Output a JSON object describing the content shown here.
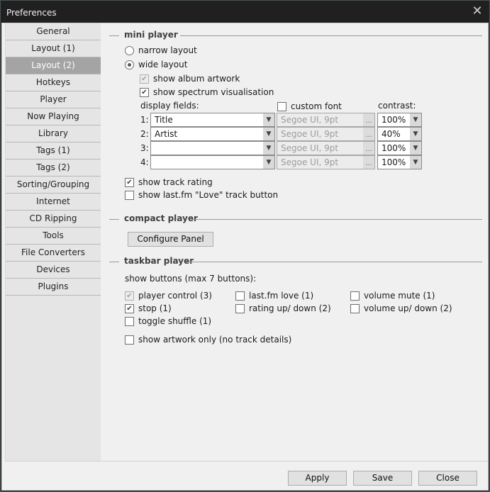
{
  "window": {
    "title": "Preferences",
    "close_glyph": "✕"
  },
  "sidebar": {
    "items": [
      {
        "label": "General"
      },
      {
        "label": "Layout (1)"
      },
      {
        "label": "Layout (2)",
        "active": true
      },
      {
        "label": "Hotkeys"
      },
      {
        "label": "Player"
      },
      {
        "label": "Now Playing"
      },
      {
        "label": "Library"
      },
      {
        "label": "Tags (1)"
      },
      {
        "label": "Tags (2)"
      },
      {
        "label": "Sorting/Grouping"
      },
      {
        "label": "Internet"
      },
      {
        "label": "CD Ripping"
      },
      {
        "label": "Tools"
      },
      {
        "label": "File Converters"
      },
      {
        "label": "Devices"
      },
      {
        "label": "Plugins"
      }
    ]
  },
  "mini_player": {
    "heading": "mini player",
    "narrow_layout": {
      "label": "narrow layout",
      "selected": false
    },
    "wide_layout": {
      "label": "wide layout",
      "selected": true
    },
    "show_album_artwork": {
      "label": "show album artwork",
      "checked": true,
      "disabled": true
    },
    "show_spectrum": {
      "label": "show spectrum visualisation",
      "checked": true
    },
    "display_fields_label": "display fields:",
    "custom_font": {
      "label": "custom font",
      "checked": false
    },
    "contrast_label": "contrast:",
    "fields": [
      {
        "num": "1:",
        "value": "Title",
        "font": "Segoe UI, 9pt",
        "contrast": "100%"
      },
      {
        "num": "2:",
        "value": "Artist",
        "font": "Segoe UI, 9pt",
        "contrast": "40%"
      },
      {
        "num": "3:",
        "value": "",
        "font": "Segoe UI, 9pt",
        "contrast": "100%"
      },
      {
        "num": "4:",
        "value": "",
        "font": "Segoe UI, 9pt",
        "contrast": "100%"
      }
    ],
    "font_button_glyph": "...",
    "dropdown_glyph": "▼",
    "check_glyph": "✔",
    "show_track_rating": {
      "label": "show track rating",
      "checked": true
    },
    "show_lastfm_love": {
      "label": "show last.fm \"Love\" track button",
      "checked": false
    }
  },
  "compact_player": {
    "heading": "compact player",
    "configure_button": "Configure Panel"
  },
  "taskbar_player": {
    "heading": "taskbar player",
    "show_buttons_label": "show buttons (max 7 buttons):",
    "buttons": [
      {
        "label": "player control (3)",
        "checked": true,
        "disabled": true
      },
      {
        "label": "last.fm love (1)",
        "checked": false
      },
      {
        "label": "volume mute (1)",
        "checked": false
      },
      {
        "label": "stop (1)",
        "checked": true
      },
      {
        "label": "rating up/ down (2)",
        "checked": false
      },
      {
        "label": "volume up/ down (2)",
        "checked": false
      },
      {
        "label": "toggle shuffle (1)",
        "checked": false
      }
    ],
    "artwork_only": {
      "label": "show artwork only (no track details)",
      "checked": false
    }
  },
  "footer": {
    "apply": "Apply",
    "save": "Save",
    "close": "Close"
  }
}
